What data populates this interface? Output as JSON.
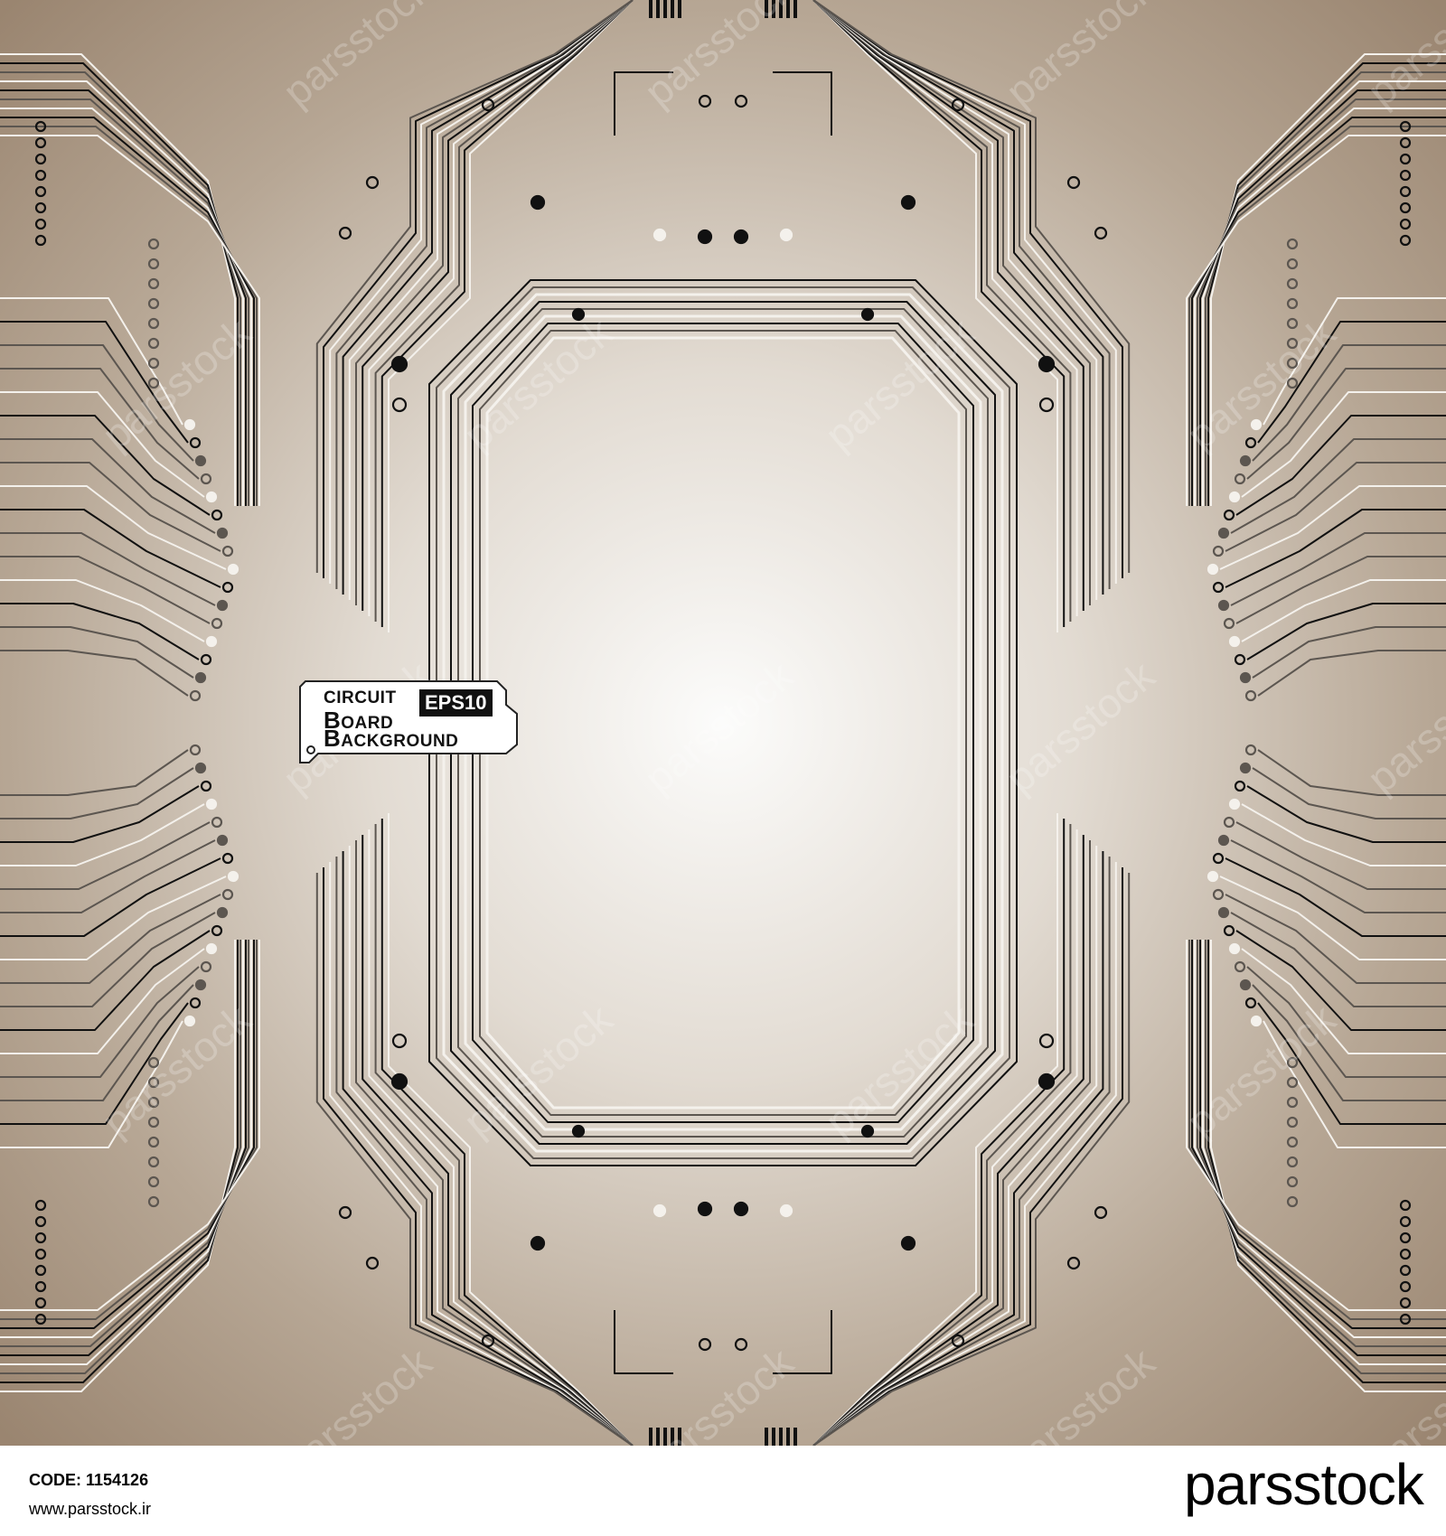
{
  "badge": {
    "line1": "CIRCUIT",
    "line2": "BOARD",
    "line3": "BACKGROUND",
    "format": "EPS10"
  },
  "watermark_text": "parsstock",
  "footer": {
    "code": "CODE: 1154126",
    "site": "www.parsstock.ir",
    "logo": "parsstock"
  },
  "colors": {
    "center": "#fbfbfa",
    "edge": "#a08c75",
    "trace_dark": "#111111",
    "trace_grey": "#5c5650",
    "trace_light": "#f4f1ec"
  }
}
